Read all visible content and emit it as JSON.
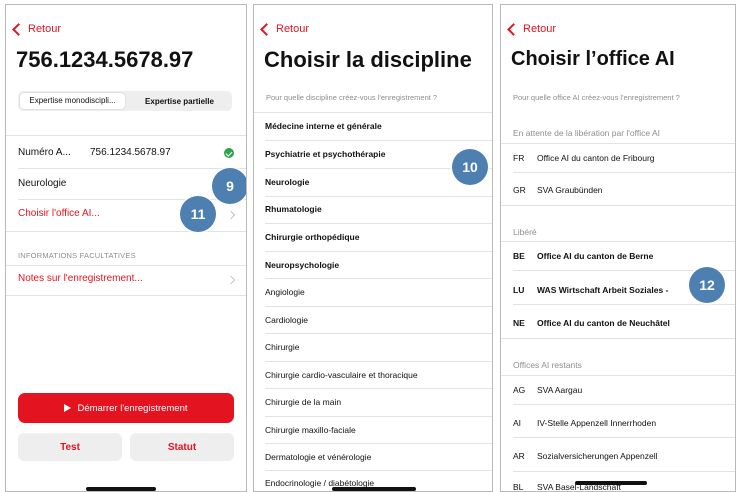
{
  "screen1": {
    "back": "Retour",
    "title": "756.1234.5678.97",
    "segments": [
      "Expertise monodiscipli...",
      "Expertise partielle"
    ],
    "number_label": "Numéro A...",
    "number_value": "756.1234.5678.97",
    "discipline": "Neurologie",
    "office_link": "Choisir l'office AI...",
    "optional_header": "INFORMATIONS FACULTATIVES",
    "notes_link": "Notes sur l'enregistrement...",
    "start_button": "Démarrer l'enregistrement",
    "test_button": "Test",
    "status_button": "Statut"
  },
  "screen2": {
    "back": "Retour",
    "title": "Choisir la discipline",
    "subtitle": "Pour quelle discipline créez-vous l'enregistrement ?",
    "disciplines": [
      "Médecine interne et générale",
      "Psychiatrie et psychothérapie",
      "Neurologie",
      "Rhumatologie",
      "Chirurgie orthopédique",
      "Neuropsychologie",
      "Angiologie",
      "Cardiologie",
      "Chirurgie",
      "Chirurgie cardio-vasculaire et thoracique",
      "Chirurgie de la main",
      "Chirurgie maxillo-faciale",
      "Dermatologie et vénérologie",
      "Endocrinologie / diabétologie"
    ]
  },
  "screen3": {
    "back": "Retour",
    "title": "Choisir l’office AI",
    "subtitle": "Pour quelle office AI créez-vous l'enregistrement ?",
    "group_pending": "En attente de la libération par l'office AI",
    "pending": [
      {
        "code": "FR",
        "name": "Office AI du canton de Fribourg"
      },
      {
        "code": "GR",
        "name": "SVA Graubünden"
      }
    ],
    "group_released": "Libéré",
    "released": [
      {
        "code": "BE",
        "name": "Office AI du canton de Berne"
      },
      {
        "code": "LU",
        "name": "WAS Wirtschaft Arbeit Soziales -"
      },
      {
        "code": "NE",
        "name": "Office AI du canton de Neuchâtel"
      }
    ],
    "group_remaining": "Offices AI restants",
    "remaining": [
      {
        "code": "AG",
        "name": "SVA Aargau"
      },
      {
        "code": "AI",
        "name": "IV-Stelle Appenzell Innerrhoden"
      },
      {
        "code": "AR",
        "name": "Sozialversicherungen Appenzell"
      },
      {
        "code": "BL",
        "name": "SVA Basel-Landschaft"
      }
    ]
  },
  "badges": [
    "9",
    "10",
    "11",
    "12"
  ],
  "colors": {
    "accent": "#e3141f",
    "badge": "#4d7fb0",
    "check": "#30a14e"
  }
}
